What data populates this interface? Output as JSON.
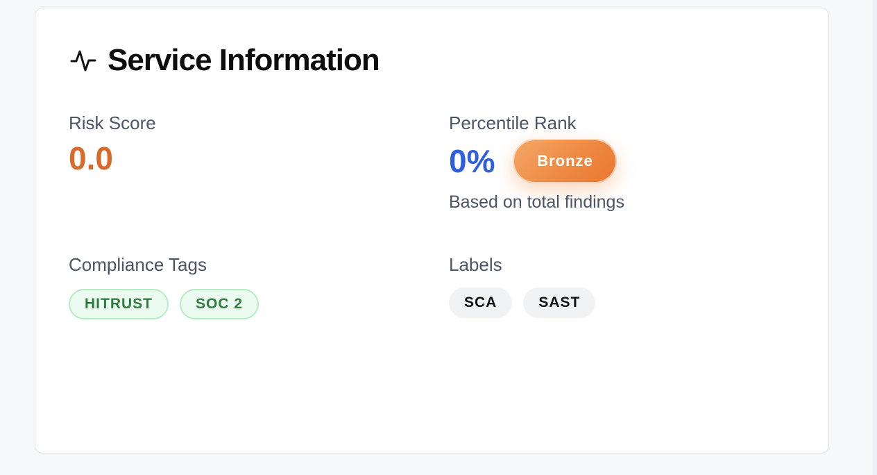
{
  "card": {
    "title": "Service Information",
    "icon": "activity-pulse-icon"
  },
  "risk": {
    "label": "Risk Score",
    "value": "0.0",
    "color": "#d86a2c"
  },
  "percentile": {
    "label": "Percentile Rank",
    "value": "0%",
    "tier": "Bronze",
    "note": "Based on total findings",
    "value_color": "#2f5fdc",
    "tier_color": "#ee8a43"
  },
  "compliance": {
    "label": "Compliance Tags",
    "tags": [
      "HITRUST",
      "SOC 2"
    ],
    "tag_color": "#2e7d3f"
  },
  "labels": {
    "label": "Labels",
    "items": [
      "SCA",
      "SAST"
    ]
  }
}
